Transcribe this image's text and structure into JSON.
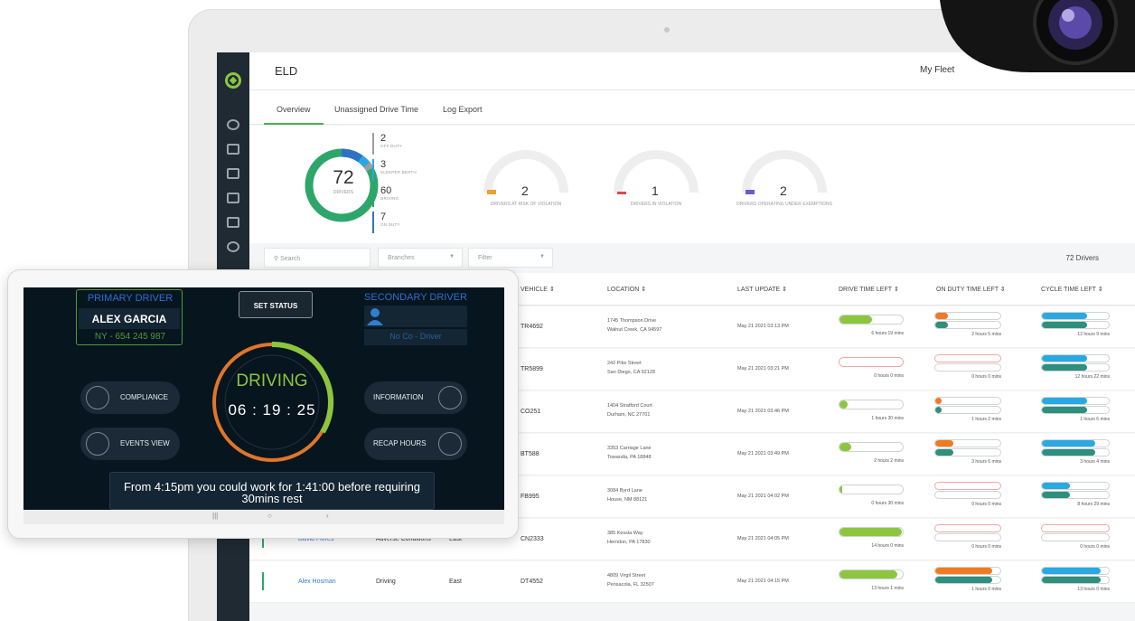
{
  "app": {
    "title": "ELD",
    "fleet": "My Fleet",
    "tabs": [
      {
        "label": "Overview"
      },
      {
        "label": "Unassigned Drive Time"
      },
      {
        "label": "Log Export"
      }
    ]
  },
  "summary": {
    "total": "72",
    "total_label": "DRIVERS",
    "stats": [
      {
        "value": "2",
        "label": "OFF DUTY",
        "color": "#9e9e9e"
      },
      {
        "value": "3",
        "label": "SLEEPER BERTH",
        "color": "#29a9e1"
      },
      {
        "value": "60",
        "label": "DRIVING",
        "color": "#2ea66b"
      },
      {
        "value": "7",
        "label": "ON DUTY",
        "color": "#2f72c4"
      }
    ],
    "gauges": [
      {
        "value": "2",
        "label": "DRIVERS AT RISK OF VIOLATION",
        "color": "#f0a030"
      },
      {
        "value": "1",
        "label": "DRIVERS IN VIOLATION",
        "color": "#e04848"
      },
      {
        "value": "2",
        "label": "DRIVERS OPERATING UNDER EXEMPTIONS",
        "color": "#6a5ad6"
      }
    ]
  },
  "filters": {
    "search_placeholder": "Search",
    "branches": "Branches",
    "filter": "Filter",
    "count": "72 Drivers"
  },
  "table": {
    "headers": [
      "VEHICLE",
      "LOCATION",
      "LAST UPDATE",
      "DRIVE TIME LEFT",
      "ON DUTY TIME LEFT",
      "CYCLE TIME LEFT"
    ],
    "rows": [
      {
        "vehicle": "TR4692",
        "loc1": "1745 Thompson Drive",
        "loc2": "Walnut Creek, CA 94597",
        "updated": "May 21 2021 03:13 PM",
        "drive": "6 hours 19 mins",
        "onduty": "2 hours 5 mins",
        "cycle": "12 hours 9 mins",
        "drive_frac": 0.52,
        "onduty_frac": 0.2,
        "cycle_frac": 0.68
      },
      {
        "vehicle": "TR5899",
        "loc1": "242 Pike Street",
        "loc2": "San Diego, CA 92128",
        "updated": "May 21 2021 03:21 PM",
        "drive": "0 hours 0 mins",
        "onduty": "0 hours 0 mins",
        "cycle": "12 hours 22 mins",
        "drive_frac": 0,
        "onduty_frac": 0,
        "cycle_frac": 0.68
      },
      {
        "vehicle": "CO251",
        "loc1": "1404 Stratford Court",
        "loc2": "Durham, NC 27701",
        "updated": "May 21 2021 03:46 PM",
        "drive": "1 hours 30 mins",
        "onduty": "1 hours 2 mins",
        "cycle": "1 hours 6 mins",
        "drive_frac": 0.13,
        "onduty_frac": 0.1,
        "cycle_frac": 0.68
      },
      {
        "vehicle": "BT588",
        "loc1": "3353 Carriage Lane",
        "loc2": "Towanda, PA 18848",
        "updated": "May 21 2021 03:49 PM",
        "drive": "2 hours 2 mins",
        "onduty": "3 hours 6 mins",
        "cycle": "3 hours 4 mins",
        "drive_frac": 0.18,
        "onduty_frac": 0.28,
        "cycle_frac": 0.8
      },
      {
        "vehicle": "FB995",
        "loc1": "3084 Byrd Lane",
        "loc2": "House, NM 88121",
        "updated": "May 21 2021 04:02 PM",
        "drive": "0 hours 30 mins",
        "onduty": "0 hours 0 mins",
        "cycle": "8 hours 29 mins",
        "drive_frac": 0.04,
        "onduty_frac": 0,
        "cycle_frac": 0.42
      },
      {
        "name": "David Flores",
        "status": "Adverse Conditions",
        "region": "East",
        "vehicle": "CN2333",
        "loc1": "385 Kessla Way",
        "loc2": "Herndon, PA 17830",
        "updated": "May 21 2021 04:05 PM",
        "drive": "14 hours 0 mins",
        "onduty": "0 hours 0 mins",
        "cycle": "0 hours 0 mins",
        "drive_frac": 0.98,
        "onduty_frac": 0,
        "cycle_frac": 0
      },
      {
        "name": "Alex Hosman",
        "status": "Driving",
        "region": "East",
        "vehicle": "DT4552",
        "loc1": "4809 Virgil Street",
        "loc2": "Pensacola, FL 32507",
        "updated": "May 21 2021 04:15 PM",
        "drive": "13 hours 1 mins",
        "onduty": "1 hours 0 mins",
        "cycle": "13 hours 0 mins",
        "drive_frac": 0.92,
        "onduty_frac": 0.88,
        "cycle_frac": 0.88
      }
    ]
  },
  "tablet": {
    "primary_title": "PRIMARY DRIVER",
    "primary_name": "ALEX GARCIA",
    "primary_id": "NY - 654 245 987",
    "secondary_title": "SECONDARY DRIVER",
    "secondary_sub": "No Co - Driver",
    "set_status": "SET STATUS",
    "compliance": "COMPLIANCE",
    "events_view": "EVENTS VIEW",
    "information": "INFORMATION",
    "recap_hours": "RECAP HOURS",
    "status": "DRIVING",
    "time": "06 : 19 : 25",
    "message": "From 4:15pm you could work for 1:41:00 before requiring 30mins rest"
  },
  "colors": {
    "green": "#8cc63f",
    "teal": "#2e8f7e",
    "orange": "#f07a20",
    "blue": "#29a9e1",
    "sidebar": "#1f2a33"
  }
}
